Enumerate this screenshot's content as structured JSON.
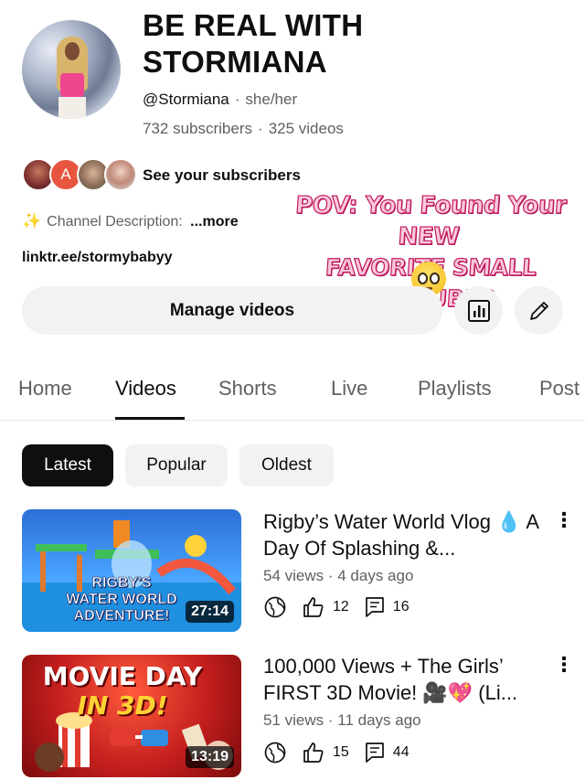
{
  "channel": {
    "name": "BE REAL WITH STORMIANA",
    "handle": "@Stormiana",
    "pronouns": "she/her",
    "subscribers": "732 subscribers",
    "videos_count": "325 videos",
    "see_subscribers": "See your subscribers",
    "description_label": "Channel Description: ",
    "description_more": "...more",
    "link": "linktr.ee/stormybabyy",
    "subscriber_avatar_letter": "A"
  },
  "overlay": {
    "line1": "POV: You Found Your NEW",
    "line2": "FAVORITE SMALL YOUTUBER",
    "emoji": "pleading-face"
  },
  "actions": {
    "manage_videos": "Manage videos",
    "analytics_icon": "analytics-icon",
    "edit_icon": "pencil-icon"
  },
  "tabs": [
    "Home",
    "Videos",
    "Shorts",
    "Live",
    "Playlists",
    "Post"
  ],
  "active_tab": "Videos",
  "filters": [
    "Latest",
    "Popular",
    "Oldest"
  ],
  "selected_filter": "Latest",
  "videos": [
    {
      "title": "Rigby’s Water World Vlog 💧 A Day Of Splashing &...",
      "thumb_text_1": "RIGBY'S",
      "thumb_text_2": "WATER WORLD",
      "thumb_text_3": "ADVENTURE!",
      "duration": "27:14",
      "views": "54 views",
      "age": "4 days ago",
      "likes": "12",
      "comments": "16"
    },
    {
      "title": "100,000 Views + The Girls’ FIRST 3D Movie! 🎥💖 (Li...",
      "thumb_text_1": "MOVIE DAY",
      "thumb_text_2": "IN 3D!",
      "duration": "13:19",
      "views": "51 views",
      "age": "11 days ago",
      "likes": "15",
      "comments": "44"
    }
  ],
  "colors": {
    "text_primary": "#0f0f0f",
    "text_secondary": "#606060",
    "chip_bg": "#f2f2f2",
    "overlay_pink": "#f9c8de"
  }
}
